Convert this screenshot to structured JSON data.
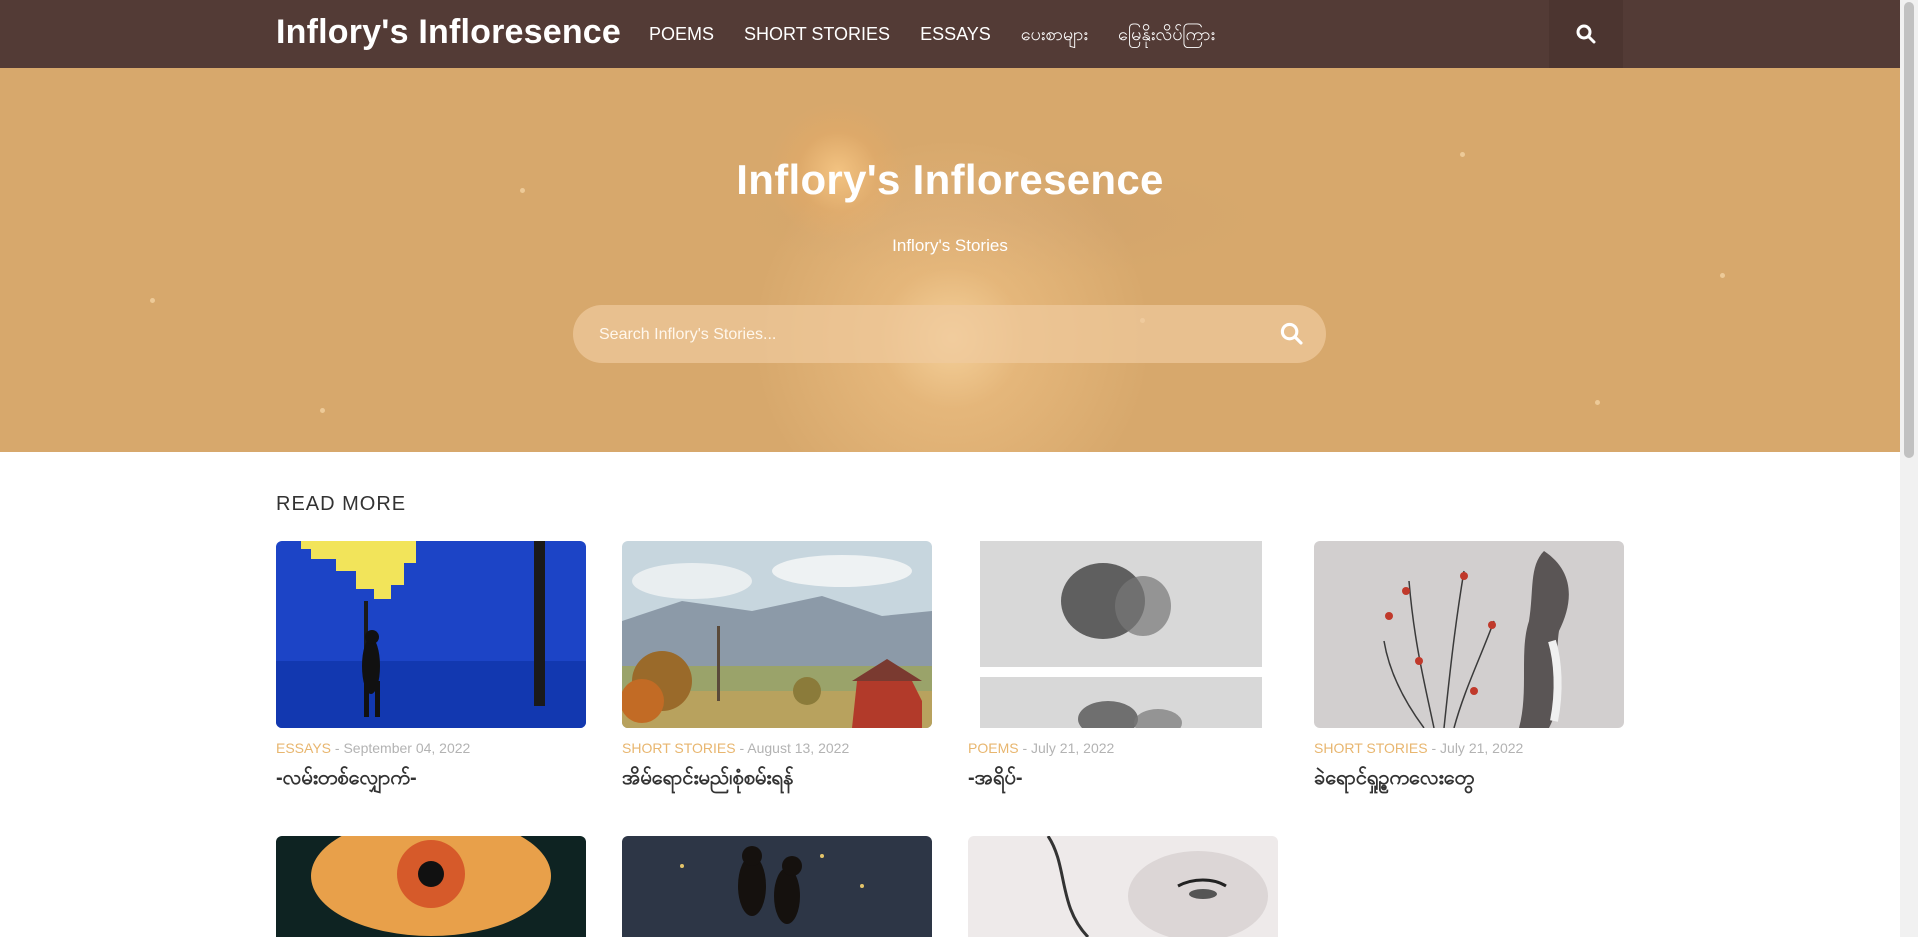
{
  "nav": {
    "brand": "Inflory's Infloresence",
    "items": [
      {
        "label": "POEMS"
      },
      {
        "label": "SHORT STORIES"
      },
      {
        "label": "ESSAYS"
      },
      {
        "label": "ပေးစာများ"
      },
      {
        "label": "မြေနိုးလိပ်ကြား"
      }
    ],
    "search_icon": "search-icon"
  },
  "hero": {
    "title": "Inflory's Infloresence",
    "subtitle": "Inflory's Stories",
    "search_placeholder": "Search Inflory's Stories..."
  },
  "section": {
    "title": "READ MORE"
  },
  "cards": [
    {
      "category": "ESSAYS",
      "date": " - September 04, 2022",
      "title": "-လမ်းတစ်လျှောက်-"
    },
    {
      "category": "SHORT STORIES",
      "date": " - August 13, 2022",
      "title": "အိမ်ရောင်းမည်၊စုံစမ်းရန်"
    },
    {
      "category": "POEMS",
      "date": " - July 21, 2022",
      "title": "-အရိပ်-"
    },
    {
      "category": "SHORT STORIES",
      "date": " - July 21, 2022",
      "title": "ခဲရောင်ရှုဥ္ဓကလေးတွေ"
    }
  ],
  "colors": {
    "nav_bg": "#533b36",
    "hero_bg": "#d7a86c",
    "category": "#e8b66f"
  }
}
